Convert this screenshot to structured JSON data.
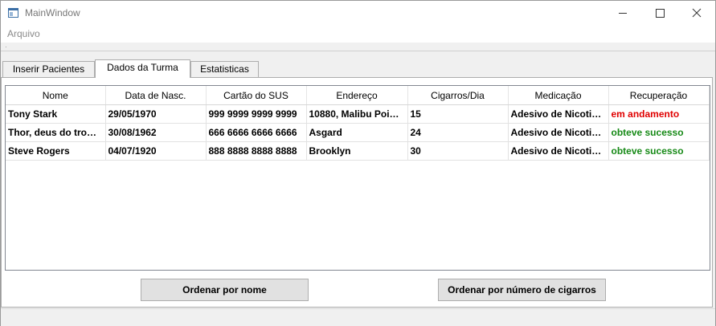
{
  "window": {
    "title": "MainWindow"
  },
  "menu": {
    "items": [
      "Arquivo"
    ]
  },
  "tabs": [
    "Inserir Pacientes",
    "Dados da Turma",
    "Estatisticas"
  ],
  "table": {
    "headers": [
      "Nome",
      "Data de Nasc.",
      "Cartão do SUS",
      "Endereço",
      "Cigarros/Dia",
      "Medicação",
      "Recuperação"
    ],
    "rows": [
      [
        "Tony Stark",
        "29/05/1970",
        "999 9999 9999 9999",
        "10880, Malibu Poi…",
        "15",
        "Adesivo de Nicoti…",
        "em andamento"
      ],
      [
        "Thor, deus do tro…",
        "30/08/1962",
        "666 6666 6666 6666",
        "Asgard",
        "24",
        "Adesivo de Nicoti…",
        "obteve sucesso"
      ],
      [
        "Steve Rogers",
        "04/07/1920",
        "888 8888 8888 8888",
        "Brooklyn",
        "30",
        "Adesivo de Nicoti…",
        "obteve sucesso"
      ]
    ]
  },
  "buttons": {
    "sort_name": "Ordenar por nome",
    "sort_cigarettes": "Ordenar por número de cigarros"
  },
  "colors": {
    "status_in_progress": "#e00000",
    "status_success": "#178a17"
  }
}
